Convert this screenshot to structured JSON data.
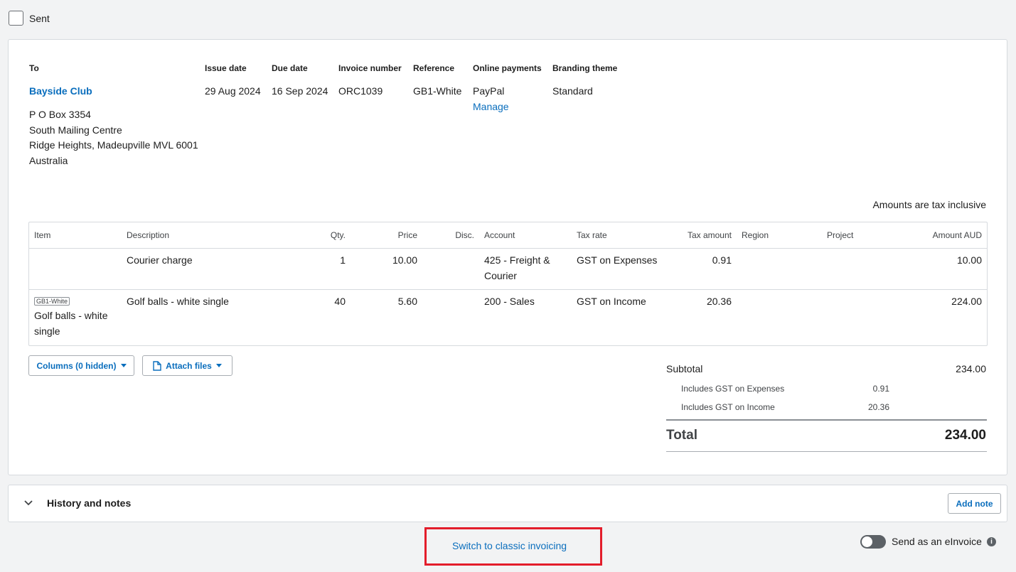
{
  "sent": {
    "label": "Sent"
  },
  "header": {
    "to_label": "To",
    "contact": "Bayside Club",
    "address": [
      "P O Box 3354",
      "South Mailing Centre",
      "Ridge Heights, Madeupville MVL 6001",
      "Australia"
    ],
    "issue_date_label": "Issue date",
    "issue_date": "29 Aug 2024",
    "due_date_label": "Due date",
    "due_date": "16 Sep 2024",
    "invoice_number_label": "Invoice number",
    "invoice_number": "ORC1039",
    "reference_label": "Reference",
    "reference": "GB1-White",
    "online_payments_label": "Online payments",
    "online_payments": "PayPal",
    "manage_link": "Manage",
    "branding_label": "Branding theme",
    "branding": "Standard"
  },
  "tax_note": "Amounts are tax inclusive",
  "table": {
    "columns": [
      "Item",
      "Description",
      "Qty.",
      "Price",
      "Disc.",
      "Account",
      "Tax rate",
      "Tax amount",
      "Region",
      "Project",
      "Amount AUD"
    ],
    "rows": [
      {
        "item_code": "",
        "item_name": "",
        "description": "Courier charge",
        "qty": "1",
        "price": "10.00",
        "disc": "",
        "account_line1": "425 - Freight &",
        "account_line2": "Courier",
        "tax_rate": "GST on Expenses",
        "tax_amount": "0.91",
        "region": "",
        "project": "",
        "amount": "10.00"
      },
      {
        "item_code": "GB1-White",
        "item_name_line1": "Golf balls - white",
        "item_name_line2": "single",
        "description": "Golf balls - white single",
        "qty": "40",
        "price": "5.60",
        "disc": "",
        "account_line1": "200 - Sales",
        "account_line2": "",
        "tax_rate": "GST on Income",
        "tax_amount": "20.36",
        "region": "",
        "project": "",
        "amount": "224.00"
      }
    ]
  },
  "buttons": {
    "columns": "Columns (0 hidden)",
    "attach": "Attach files"
  },
  "totals": {
    "subtotal_label": "Subtotal",
    "subtotal": "234.00",
    "gst_expenses_label": "Includes GST on Expenses",
    "gst_expenses": "0.91",
    "gst_income_label": "Includes GST on Income",
    "gst_income": "20.36",
    "total_label": "Total",
    "total": "234.00"
  },
  "history": {
    "title": "History and notes",
    "add_note": "Add note"
  },
  "footer": {
    "switch_link": "Switch to classic invoicing",
    "einvoice_label": "Send as an eInvoice"
  },
  "colors": {
    "link": "#0a6ebd",
    "highlight": "#e31d2b",
    "background": "#f2f3f4"
  }
}
